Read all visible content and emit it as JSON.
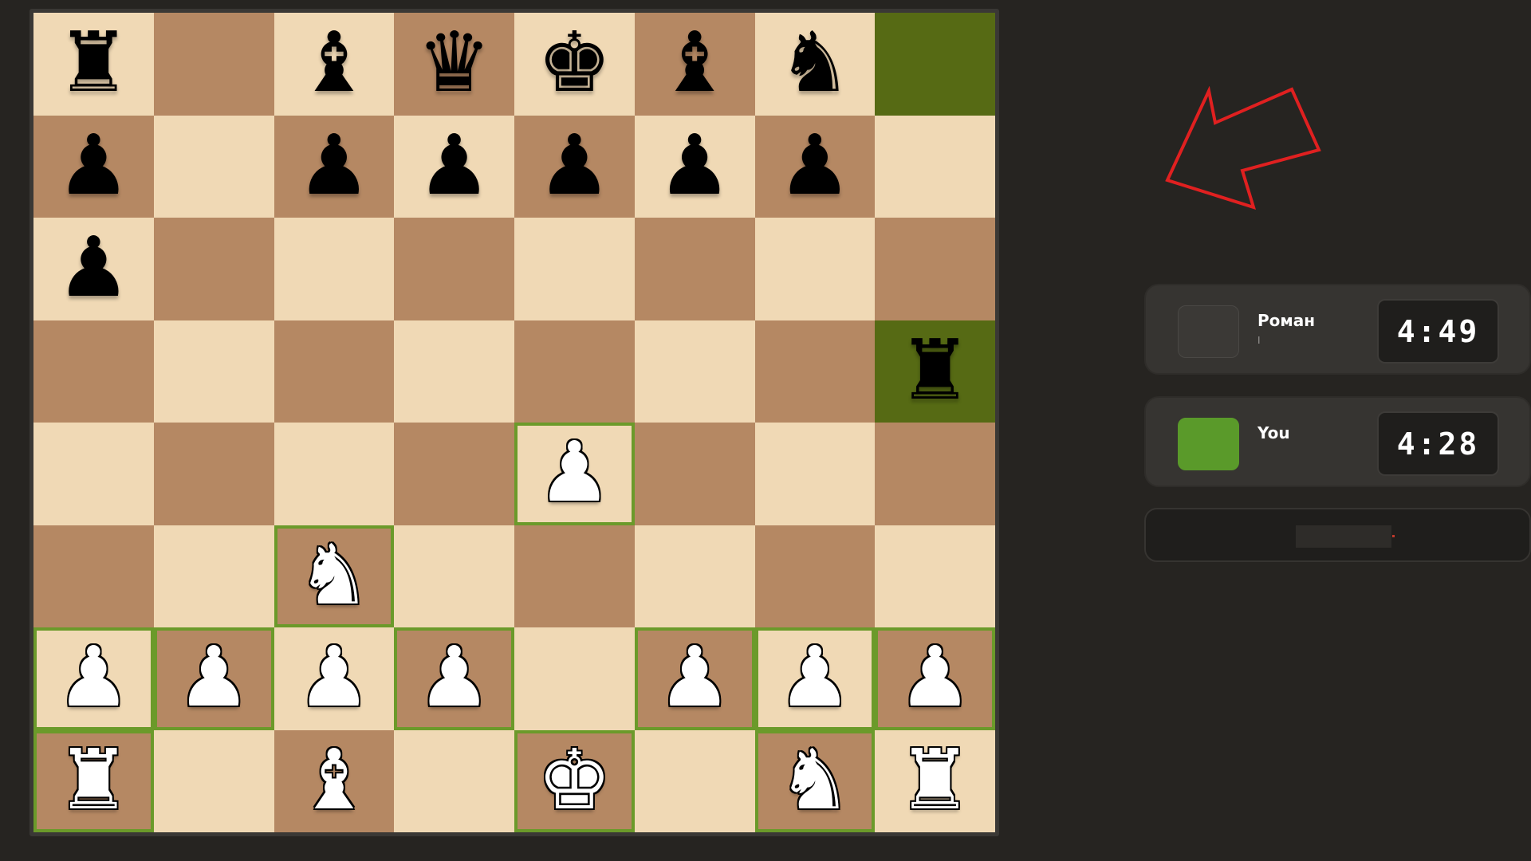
{
  "board": {
    "rows": [
      [
        "bR",
        "",
        "bB",
        "bQ",
        "bK",
        "bB",
        "bN",
        ""
      ],
      [
        "bP",
        "",
        "bP",
        "bP",
        "bP",
        "bP",
        "bP",
        ""
      ],
      [
        "bP",
        "",
        "",
        "",
        "",
        "",
        "",
        ""
      ],
      [
        "",
        "",
        "",
        "",
        "",
        "",
        "",
        "bR"
      ],
      [
        "",
        "",
        "",
        "",
        "wP",
        "",
        "",
        ""
      ],
      [
        "",
        "",
        "wN",
        "",
        "",
        "",
        "",
        ""
      ],
      [
        "wP",
        "wP",
        "wP",
        "wP",
        "",
        "wP",
        "wP",
        "wP"
      ],
      [
        "wR",
        "",
        "wB",
        "",
        "wK",
        "",
        "wN",
        "wR"
      ]
    ],
    "highlight_squares": [
      "0-7",
      "3-7"
    ],
    "legal_outline_squares": [
      "4-4",
      "5-2",
      "6-0",
      "6-1",
      "6-3",
      "6-5",
      "6-6",
      "6-7",
      "7-0",
      "7-4",
      "7-6"
    ],
    "colors": {
      "light": "#f0d9b5",
      "dark": "#b58863",
      "highlight": "#566a14",
      "outline": "#6b9a2a"
    }
  },
  "pieces": {
    "K": "♚",
    "Q": "♛",
    "R": "♜",
    "B": "♝",
    "N": "♞",
    "P": "♟"
  },
  "annotation": {
    "arrow_color": "#e02020",
    "icon": "arrow-icon"
  },
  "opponent": {
    "name": "Роман",
    "subtext": "I",
    "clock": "4:49"
  },
  "player": {
    "name": "You",
    "subtext": "",
    "clock": "4:28",
    "avatar_color": "#5a9a2a"
  }
}
